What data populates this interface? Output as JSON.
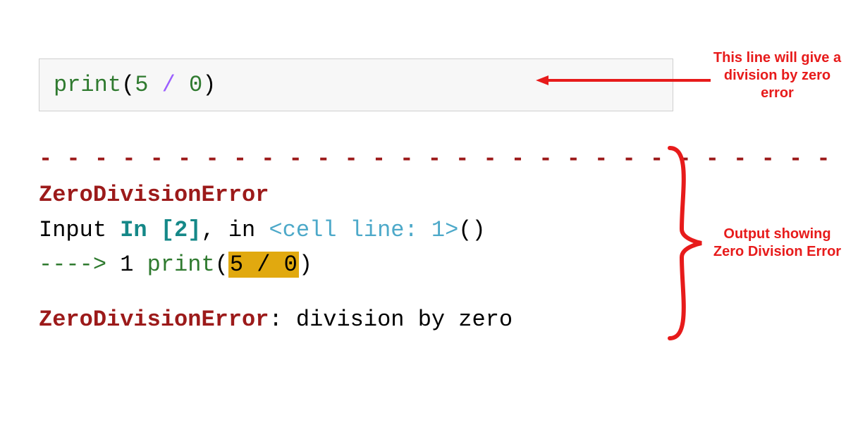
{
  "code_cell": {
    "fn": "print",
    "lparen": "(",
    "num1": "5",
    "slash": " / ",
    "num2": "0",
    "rparen": ")"
  },
  "dashes": "- - - - - - - - - - - - - - - - - - - - - - - - - - - - - - - - - - - - - -",
  "output": {
    "error_name": "ZeroDivisionError",
    "line2_input": "Input ",
    "line2_in": "In ",
    "line2_bracket_open": "[",
    "line2_exec_count": "2",
    "line2_bracket_close": "]",
    "line2_comma": ", ",
    "line2_in2": "in ",
    "line2_cell": "<cell line: 1>",
    "line2_parens": "()",
    "line3_arrow": "----> ",
    "line3_lineno": "1 ",
    "line3_fn": "print",
    "line3_lparen": "(",
    "line3_hl": "5 / 0",
    "line3_rparen": ")",
    "final_err": "ZeroDivisionError",
    "final_colon": ": ",
    "final_msg": "division by zero"
  },
  "annotations": {
    "top_right": "This line will give a division by zero error",
    "mid_right": "Output showing Zero Division Error"
  }
}
